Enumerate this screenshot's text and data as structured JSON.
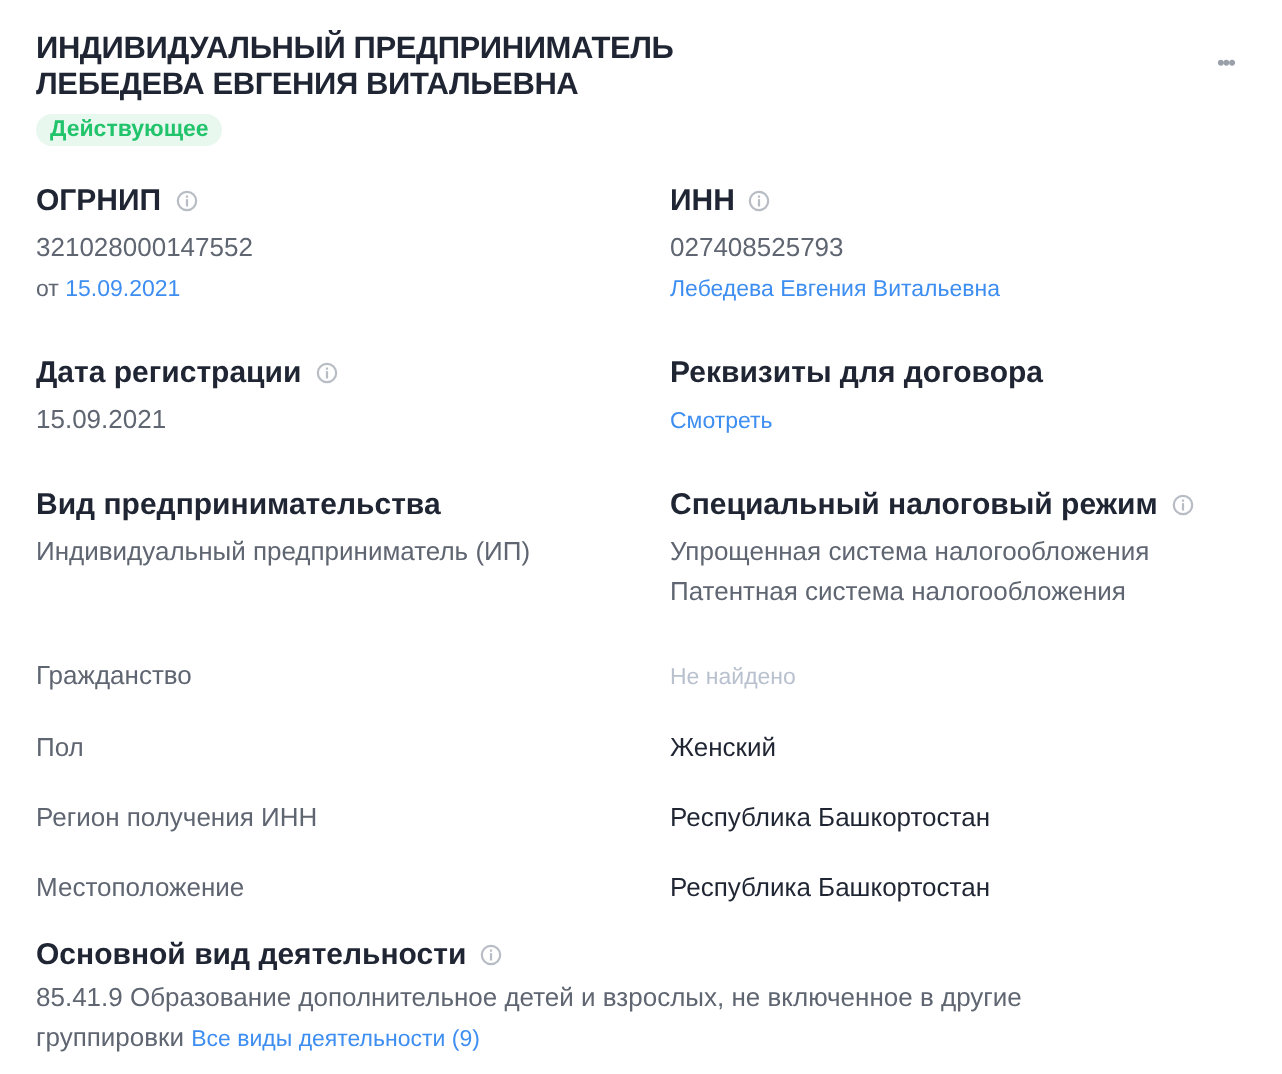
{
  "header": {
    "title_lines": [
      "ИНДИВИДУАЛЬНЫЙ ПРЕДПРИНИМАТЕЛЬ",
      "ЛЕБЕДЕВА ЕВГЕНИЯ ВИТАЛЬЕВНА"
    ],
    "status": "Действующее",
    "menu": "•••"
  },
  "blocks": [
    {
      "title": "ОГРНИП",
      "info": true,
      "lines": [
        [
          {
            "kind": "plain",
            "text": "321028000147552"
          }
        ],
        [
          {
            "kind": "small",
            "text": "от "
          },
          {
            "kind": "link",
            "text": "15.09.2021"
          }
        ]
      ]
    },
    {
      "title": "ИНН",
      "info": true,
      "lines": [
        [
          {
            "kind": "plain",
            "text": "027408525793"
          }
        ],
        [
          {
            "kind": "link",
            "text": "Лебедева Евгения Витальевна"
          }
        ]
      ]
    },
    {
      "title": "Дата регистрации",
      "info": true,
      "lines": [
        [
          {
            "kind": "plain",
            "text": "15.09.2021"
          }
        ]
      ]
    },
    {
      "title": "Реквизиты для договора",
      "info": false,
      "lines": [
        [
          {
            "kind": "link",
            "text": "Смотреть"
          }
        ]
      ]
    },
    {
      "title": "Вид предпринимательства",
      "info": false,
      "lines": [
        [
          {
            "kind": "plain",
            "text": "Индивидуальный предприниматель (ИП)"
          }
        ]
      ]
    },
    {
      "title": "Специальный налоговый режим",
      "info": true,
      "lines": [
        [
          {
            "kind": "plain",
            "text": "Упрощенная система налогообложения"
          }
        ],
        [
          {
            "kind": "plain",
            "text": "Патентная система налогообложения"
          }
        ]
      ]
    }
  ],
  "properties": [
    {
      "label": "Гражданство",
      "value": "Не найдено",
      "missing": true
    },
    {
      "label": "Пол",
      "value": "Женский",
      "missing": false
    },
    {
      "label": "Регион получения ИНН",
      "value": "Республика Башкортостан",
      "missing": false
    },
    {
      "label": "Местоположение",
      "value": "Республика Башкортостан",
      "missing": false
    }
  ],
  "activity": {
    "title": "Основной вид деятельности",
    "info": true,
    "text": "85.41.9 Образование дополнительное детей и взрослых, не включенное в другие группировки",
    "link": "Все виды деятельности (9)"
  }
}
